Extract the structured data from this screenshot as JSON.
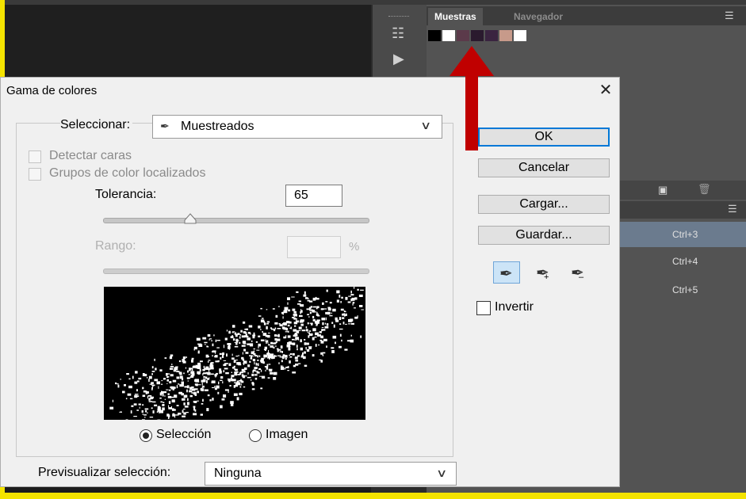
{
  "app": {
    "panel_tabs": [
      "Muestras",
      "Navegador"
    ],
    "panel_menu_icon": "panel-menu-icon",
    "swatch_colors": [
      "#000000",
      "#ffffff",
      "#5b3a4a",
      "#2a1a2e",
      "#3a2440",
      "#c79a8a",
      "#ffffff"
    ],
    "shortcuts": [
      "Ctrl+3",
      "Ctrl+4",
      "Ctrl+5"
    ],
    "annotation_arrow_color": "#c00000",
    "frame_color": "#f4e300"
  },
  "dialog": {
    "title": "Gama de colores",
    "close_icon": "close-icon",
    "select_label": "Seleccionar:",
    "select_value": "Muestreados",
    "detect_faces_label": "Detectar caras",
    "localized_groups_label": "Grupos de color localizados",
    "tolerance_label": "Tolerancia:",
    "tolerance_value": "65",
    "tolerance_fraction": 0.33,
    "range_label": "Rango:",
    "range_value": "",
    "range_unit": "%",
    "view_options": [
      "Selección",
      "Imagen"
    ],
    "view_selected": "Selección",
    "preview_label": "Previsualizar selección:",
    "preview_value": "Ninguna",
    "buttons": {
      "ok": "OK",
      "cancel": "Cancelar",
      "load": "Cargar...",
      "save": "Guardar..."
    },
    "eyedroppers": [
      "eyedropper-icon",
      "eyedropper-add-icon",
      "eyedropper-subtract-icon"
    ],
    "invert_label": "Invertir",
    "accent": "#0078d7"
  }
}
